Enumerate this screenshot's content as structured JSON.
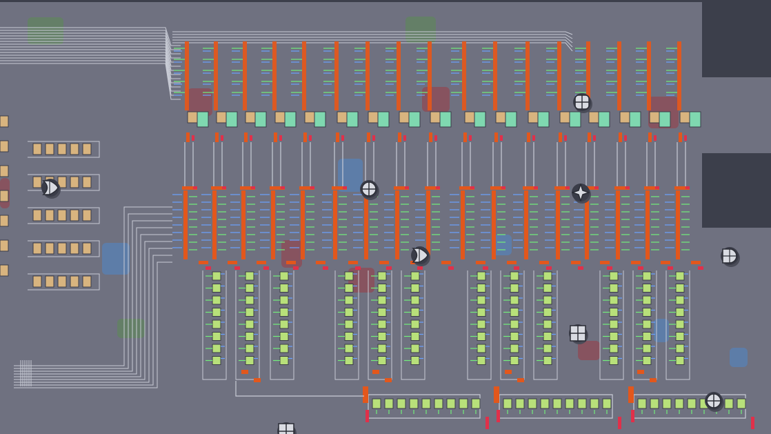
{
  "scene": {
    "kind": "circuit-sandbox-board",
    "colors": {
      "background": "#6f7180",
      "darkPanel": "#3c3f4b",
      "wire": "#c9ccd6",
      "busOrange": "#e2571c",
      "pinRed": "#e0304a",
      "pinBlue": "#6aa2ff",
      "pinGreen": "#72f07a",
      "chipTan": "#d8b47f",
      "chipMint": "#7fd8b0",
      "chipLime": "#b8e07a",
      "greenBlob": "#5b8a52",
      "redBlob": "#9a3a44",
      "blueBlob": "#4f86c8"
    },
    "gateIcons": [
      "crosshair-circle-icon",
      "or-gate-icon",
      "star-gate-icon",
      "and-gate-icon",
      "square-grid-icon"
    ]
  }
}
